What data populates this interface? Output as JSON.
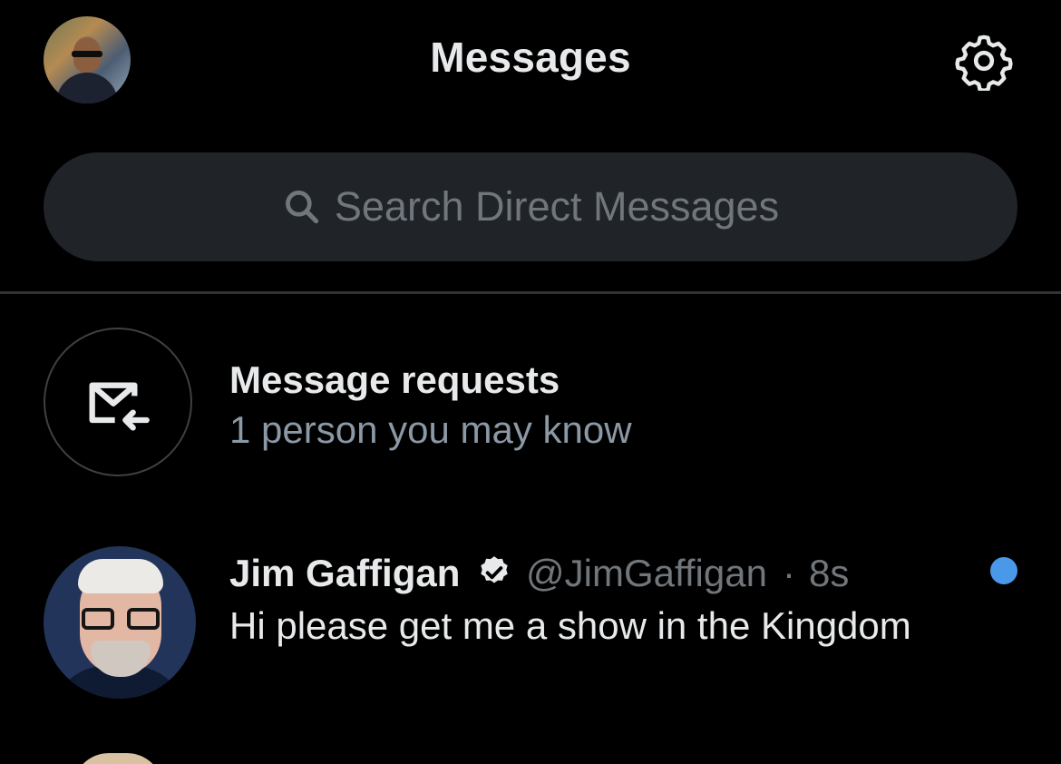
{
  "header": {
    "title": "Messages",
    "avatar_icon": "profile-avatar",
    "settings_icon": "gear-icon"
  },
  "search": {
    "placeholder": "Search Direct Messages",
    "icon": "search-icon"
  },
  "message_requests": {
    "title": "Message requests",
    "subtitle": "1 person you may know",
    "icon": "envelope-arrow-icon"
  },
  "conversations": [
    {
      "name": "Jim Gaffigan",
      "verified": true,
      "handle": "@JimGaffigan",
      "separator": "·",
      "time": "8s",
      "preview": "Hi please get me a show in the Kingdom",
      "unread": true
    }
  ],
  "colors": {
    "background": "#000000",
    "primary_text": "#e7e9ea",
    "secondary_text": "#71767b",
    "subtitle_text": "#8b98a5",
    "search_bg": "#202327",
    "unread_dot": "#4a99e9",
    "divider": "#2f3336"
  }
}
